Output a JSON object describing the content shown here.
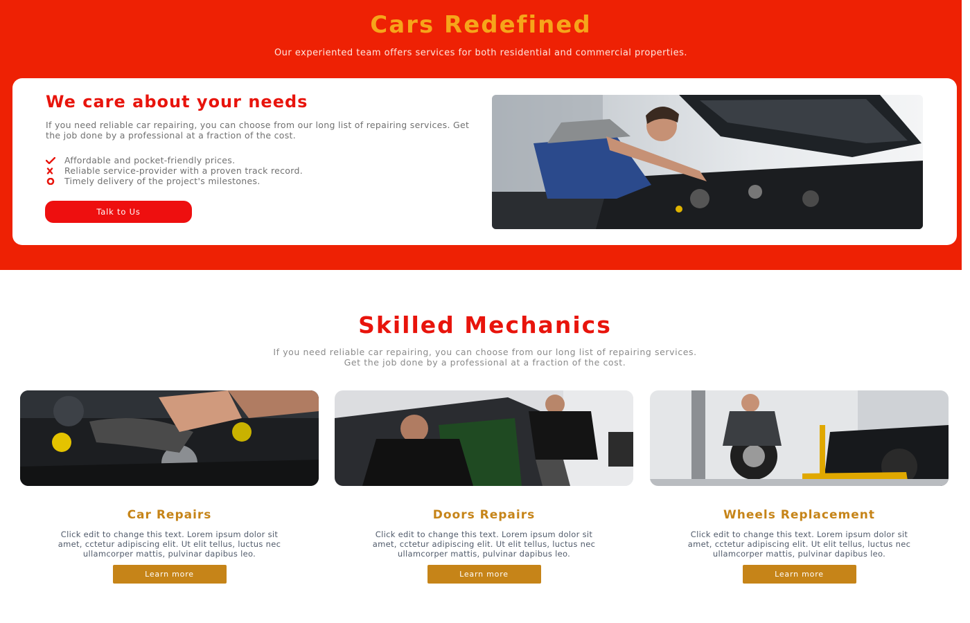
{
  "hero": {
    "title": "Cars Redefined",
    "subtitle": "Our experiented team offers services for both residential and commercial properties."
  },
  "care": {
    "title": "We care about your needs",
    "text": "If you need reliable car repairing, you can choose from our long list of repairing services. Get the job done by a professional at a fraction of the cost.",
    "list": [
      {
        "icon": "check-icon",
        "text": "Affordable and pocket-friendly prices."
      },
      {
        "icon": "close-icon",
        "text": "Reliable service-provider with a proven track record."
      },
      {
        "icon": "circle-icon",
        "text": "Timely delivery of the project's milestones."
      }
    ],
    "button_label": "Talk to Us"
  },
  "mechanics": {
    "title": "Skilled Mechanics",
    "subtitle_line1": "If you need reliable car repairing, you can choose from our long list of repairing services.",
    "subtitle_line2": "Get the job done by a professional at a fraction of the cost."
  },
  "services": [
    {
      "title": "Car Repairs",
      "text": "Click edit to change this text. Lorem ipsum dolor sit amet, cctetur adipiscing elit. Ut elit tellus, luctus nec ullamcorper mattis, pulvinar dapibus leo.",
      "button_label": "Learn more"
    },
    {
      "title": "Doors Repairs",
      "text": "Click edit to change this text. Lorem ipsum dolor sit amet, cctetur adipiscing elit. Ut elit tellus, luctus nec ullamcorper mattis, pulvinar dapibus leo.",
      "button_label": "Learn more"
    },
    {
      "title": "Wheels Replacement",
      "text": "Click edit to change this text. Lorem ipsum dolor sit amet, cctetur adipiscing elit. Ut elit tellus, luctus nec ullamcorper mattis, pulvinar dapibus leo.",
      "button_label": "Learn more"
    }
  ],
  "colors": {
    "hero_background": "#ee2104",
    "accent_red": "#e8140c",
    "hero_title": "#f6a51a",
    "gold": "#c68418"
  }
}
